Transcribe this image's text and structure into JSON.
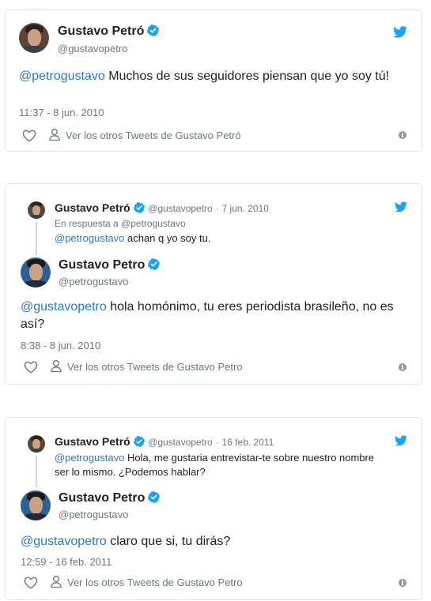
{
  "colors": {
    "link": "#2b7bb9",
    "verified": "#1da1f2",
    "twitter": "#1da1f2",
    "meta": "#697882"
  },
  "icons": [
    "twitter-bird-icon",
    "verified-badge-icon",
    "heart-icon",
    "user-icon",
    "info-icon"
  ],
  "tweets": [
    {
      "name": "Gustavo Petró",
      "handle": "@gustavopetro",
      "mention": "@petrogustavo",
      "text": " Muchos de sus seguidores piensan que yo soy tú!",
      "time": "11:37 - 8 jun. 2010",
      "more": "Ver los otros Tweets de Gustavo Petró"
    },
    {
      "reply_parent": {
        "name": "Gustavo Petró",
        "handle": "@gustavopetro",
        "date": "· 7 jun. 2010",
        "reply_to": "En respuesta a @petrogustavo",
        "mention": "@petrogustavo",
        "text": " achan q yo soy tu."
      },
      "name": "Gustavo Petro",
      "handle": "@petrogustavo",
      "mention": "@gustavopetro",
      "text": " hola homónimo, tu eres periodista brasileño, no es así?",
      "time": "8:38 - 8 jun. 2010",
      "more": "Ver los otros Tweets de Gustavo Petro"
    },
    {
      "reply_parent": {
        "name": "Gustavo Petró",
        "handle": "@gustavopetro",
        "date": "· 16 feb. 2011",
        "mention": "@petrogustavo",
        "text": " Hola, me gustaria entrevistar-te sobre nuestro nombre ser lo mismo. ¿Podemos hablar?"
      },
      "name": "Gustavo Petro",
      "handle": "@petrogustavo",
      "mention": "@gustavopetro",
      "text": " claro que si, tu dirás?",
      "time": "12:59 - 16 feb. 2011",
      "more": "Ver los otros Tweets de Gustavo Petro"
    }
  ]
}
